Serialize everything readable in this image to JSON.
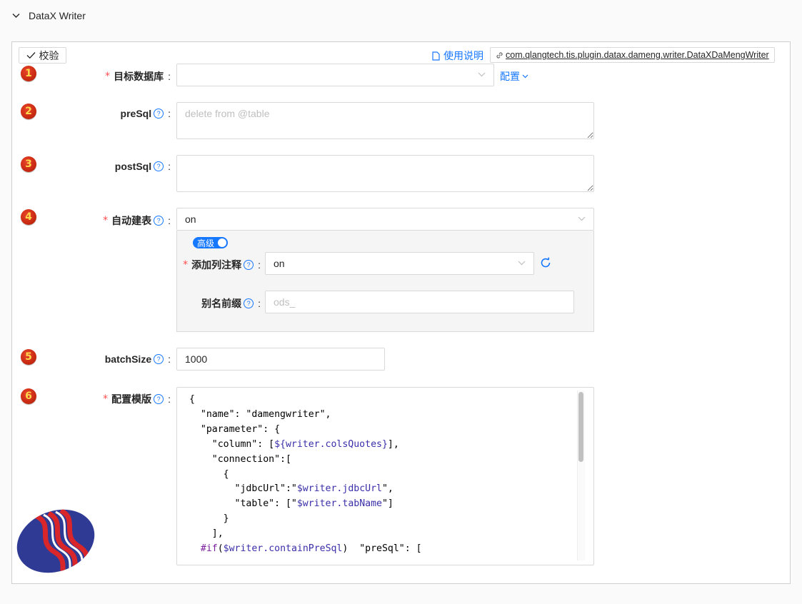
{
  "header": {
    "title": "DataX Writer"
  },
  "toolbar": {
    "validate_label": "校验",
    "doc_label": "使用说明",
    "plugin_class": "com.qlangtech.tis.plugin.datax.dameng.writer.DataXDaMengWriter"
  },
  "fields": {
    "target_db": {
      "index": "1",
      "label": "目标数据库",
      "required": true,
      "value": "",
      "config_label": "配置"
    },
    "pre_sql": {
      "index": "2",
      "label": "preSql",
      "placeholder": "delete from @table",
      "value": ""
    },
    "post_sql": {
      "index": "3",
      "label": "postSql",
      "placeholder": "",
      "value": ""
    },
    "auto_create": {
      "index": "4",
      "label": "自动建表",
      "required": true,
      "value": "on",
      "advanced_label": "高级",
      "add_comment": {
        "label": "添加列注释",
        "required": true,
        "value": "on"
      },
      "alias_prefix": {
        "label": "别名前缀",
        "placeholder": "ods_",
        "value": ""
      }
    },
    "batch_size": {
      "index": "5",
      "label": "batchSize",
      "value": "1000"
    },
    "template": {
      "index": "6",
      "label": "配置模版",
      "required": true,
      "lines": [
        "{",
        "  \"name\": \"damengwriter\",",
        "  \"parameter\": {",
        "    \"column\": [${writer.colsQuotes}],",
        "    \"connection\":[",
        "      {",
        "        \"jdbcUrl\":\"$writer.jdbcUrl\",",
        "        \"table\": [\"$writer.tabName\"]",
        "      }",
        "    ],",
        "  #if($writer.containPreSql)  \"preSql\": ["
      ]
    }
  },
  "colors": {
    "accent": "#1677ff",
    "required": "#ff4d4f",
    "badge": "#c92a12",
    "logo_blue": "#2e3a93",
    "logo_red": "#d8262b"
  }
}
